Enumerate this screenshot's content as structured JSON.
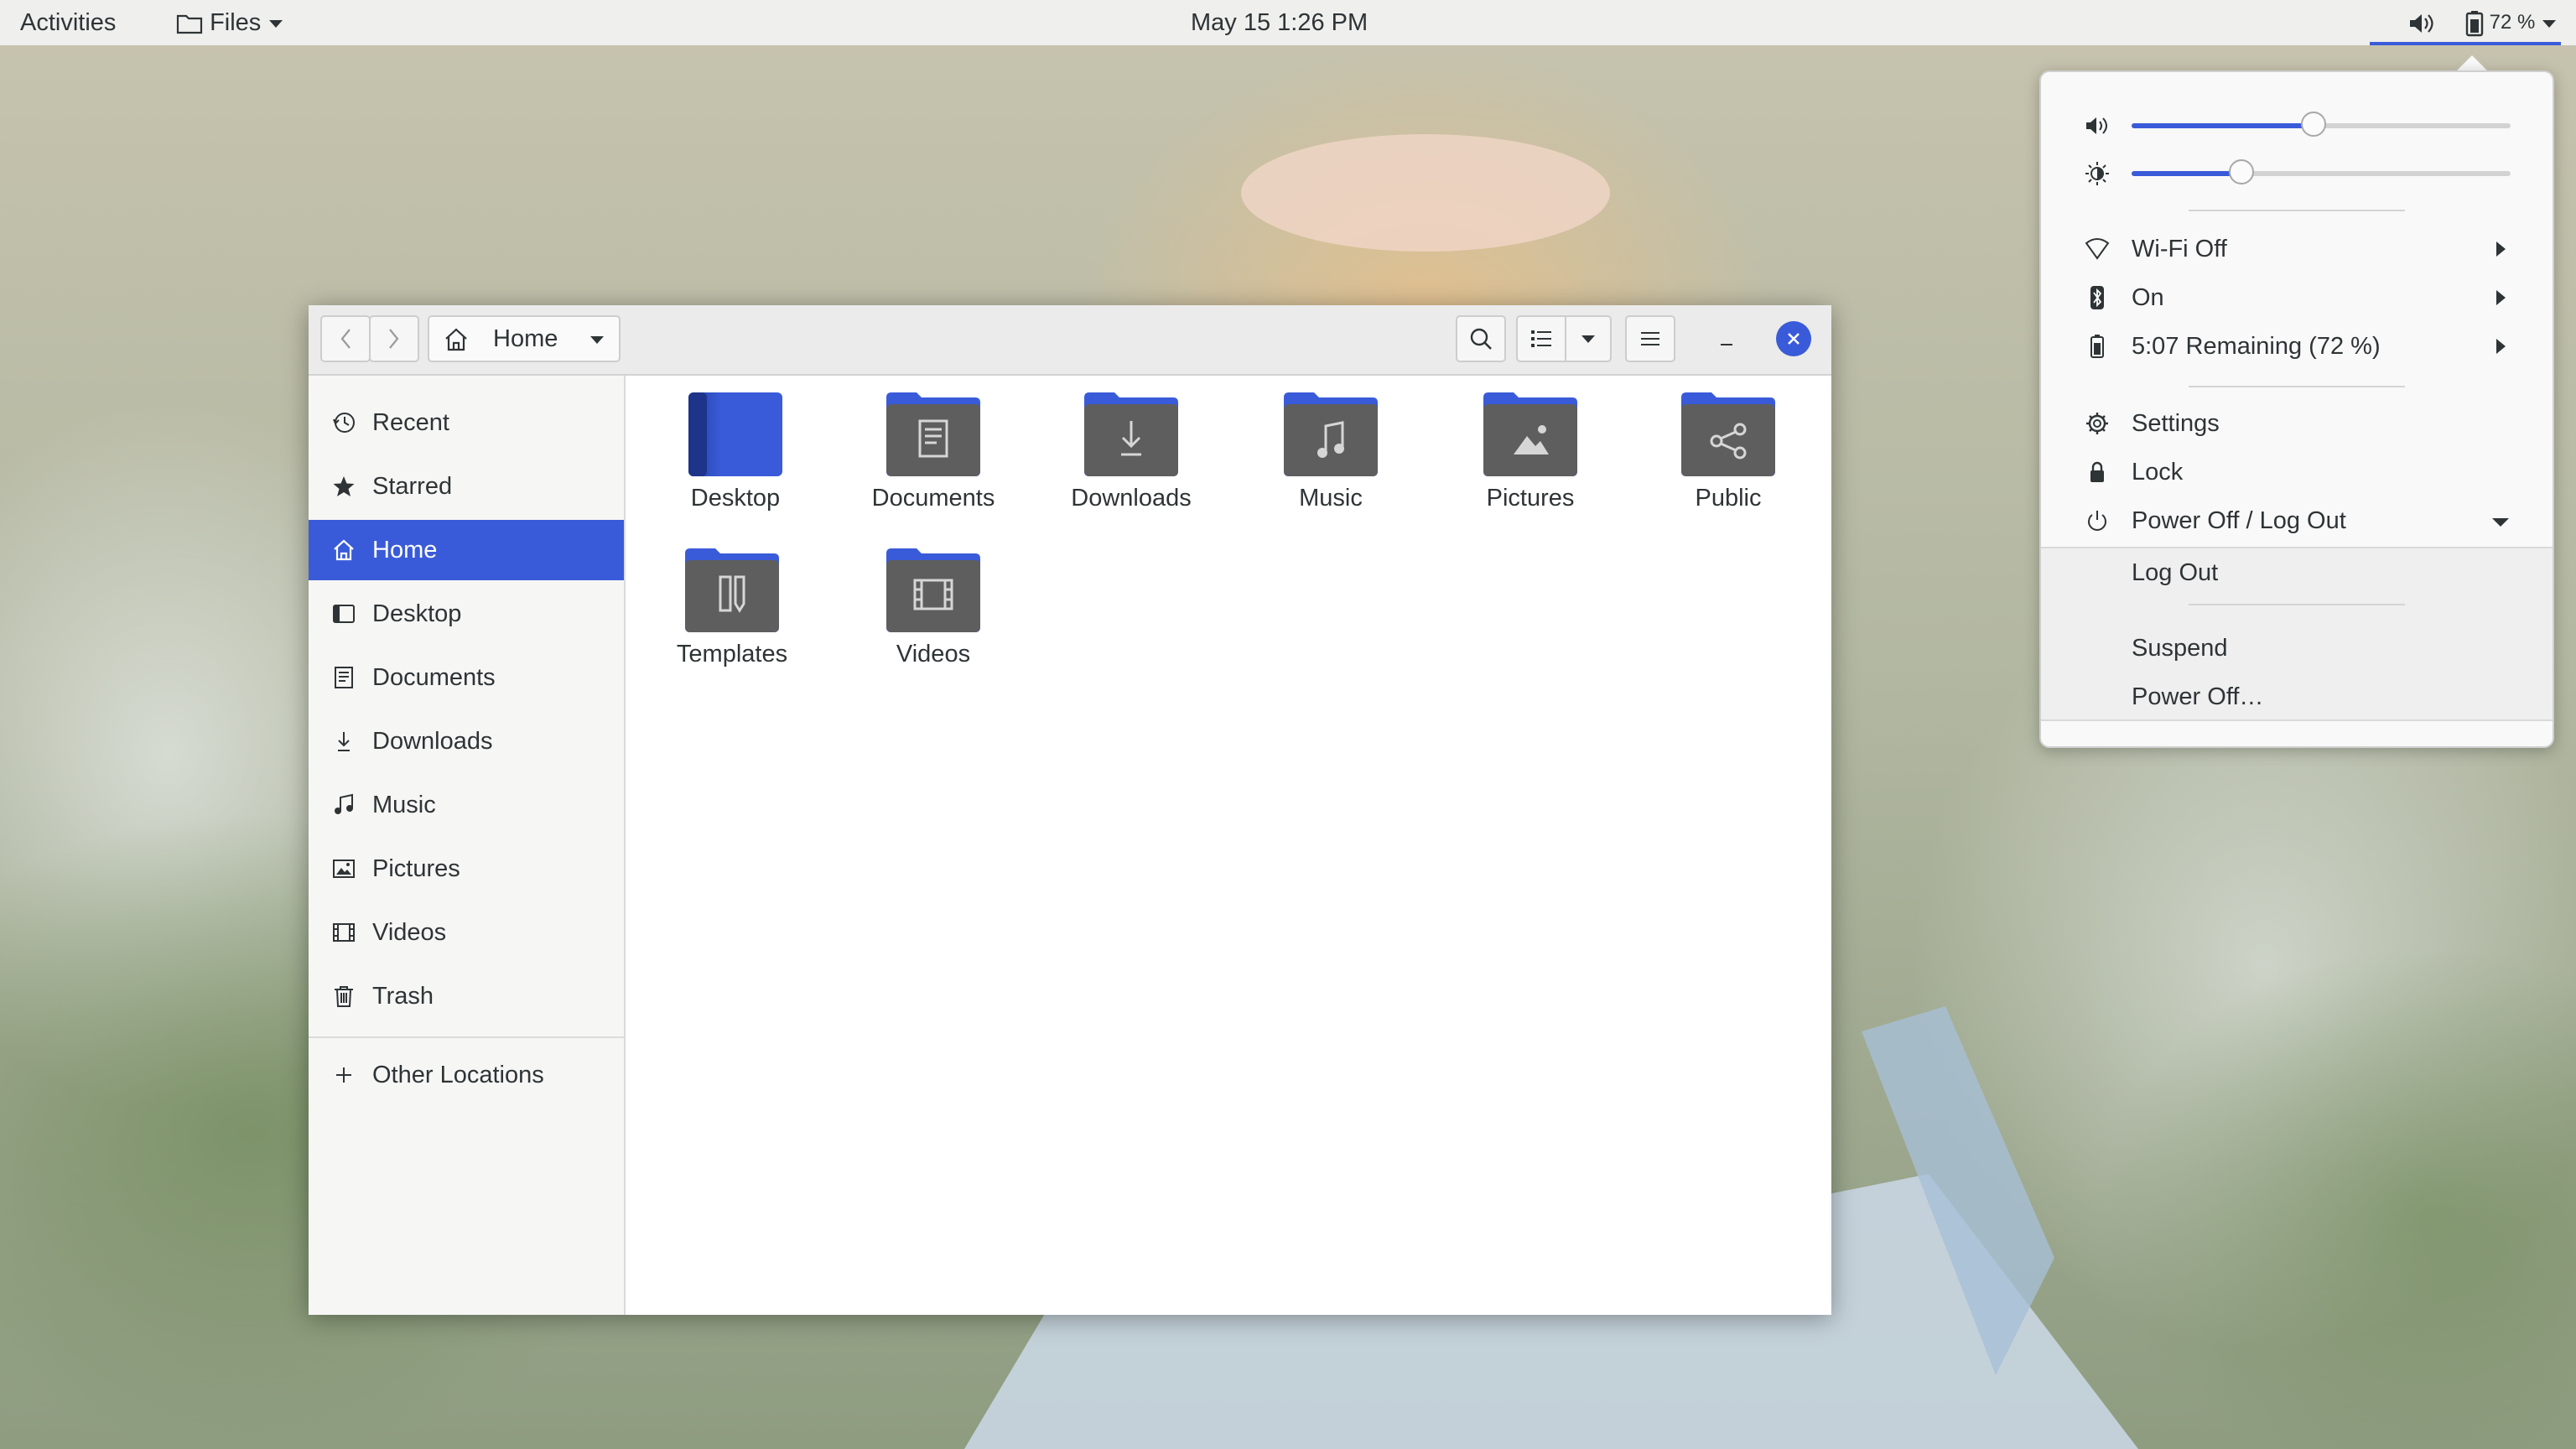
{
  "topbar": {
    "activities": "Activities",
    "app_menu": "Files",
    "clock": "May 15   1:26 PM",
    "battery_percent": "72 %"
  },
  "file_manager": {
    "path_label": "Home",
    "sidebar": [
      {
        "label": "Recent",
        "icon": "recent-icon"
      },
      {
        "label": "Starred",
        "icon": "star-icon"
      },
      {
        "label": "Home",
        "icon": "home-icon",
        "active": true
      },
      {
        "label": "Desktop",
        "icon": "desktop-icon"
      },
      {
        "label": "Documents",
        "icon": "documents-icon"
      },
      {
        "label": "Downloads",
        "icon": "downloads-icon"
      },
      {
        "label": "Music",
        "icon": "music-icon"
      },
      {
        "label": "Pictures",
        "icon": "pictures-icon"
      },
      {
        "label": "Videos",
        "icon": "videos-icon"
      },
      {
        "label": "Trash",
        "icon": "trash-icon"
      }
    ],
    "other_locations": "Other Locations",
    "files": [
      {
        "label": "Desktop",
        "icon": "desktop-folder-icon"
      },
      {
        "label": "Documents",
        "icon": "documents-folder-icon"
      },
      {
        "label": "Downloads",
        "icon": "downloads-folder-icon"
      },
      {
        "label": "Music",
        "icon": "music-folder-icon"
      },
      {
        "label": "Pictures",
        "icon": "pictures-folder-icon"
      },
      {
        "label": "Public",
        "icon": "public-folder-icon"
      },
      {
        "label": "Templates",
        "icon": "templates-folder-icon"
      },
      {
        "label": "Videos",
        "icon": "videos-folder-icon"
      }
    ]
  },
  "system_menu": {
    "volume_level": 0.48,
    "brightness_level": 0.29,
    "wifi": "Wi-Fi Off",
    "bluetooth": "On",
    "battery": "5:07 Remaining (72 %)",
    "settings": "Settings",
    "lock": "Lock",
    "power": "Power Off / Log Out",
    "log_out": "Log Out",
    "suspend": "Suspend",
    "power_off": "Power Off…"
  },
  "colors": {
    "accent": "#3a5bd9",
    "topbar": "#efefee",
    "folder_body": "#5e5e5e",
    "folder_tab": "#3a5bd9"
  }
}
